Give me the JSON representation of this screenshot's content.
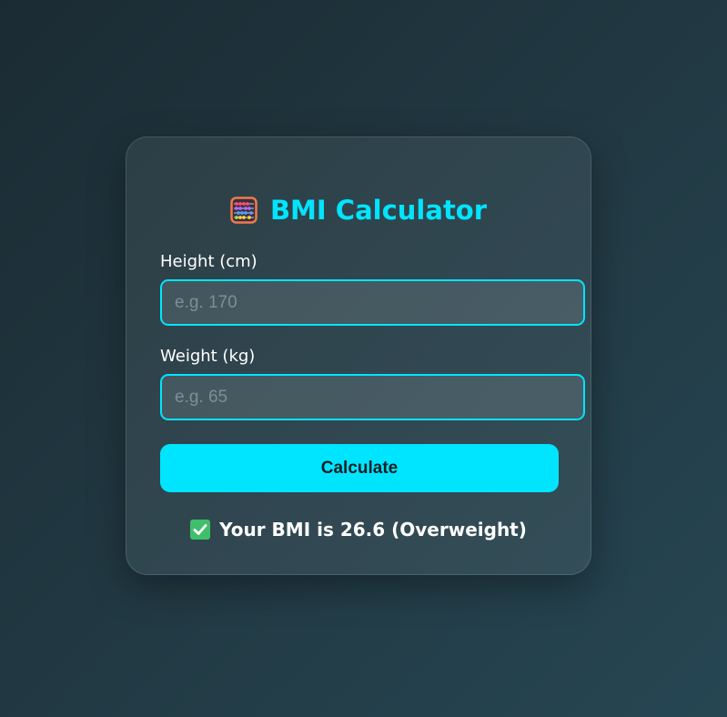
{
  "card": {
    "title": "BMI Calculator",
    "title_icon": "abacus-icon"
  },
  "form": {
    "height": {
      "label": "Height (cm)",
      "value": "",
      "placeholder": "e.g. 170"
    },
    "weight": {
      "label": "Weight (kg)",
      "value": "",
      "placeholder": "e.g. 65"
    },
    "button_label": "Calculate"
  },
  "result": {
    "icon": "check-mark-icon",
    "text": "Your BMI is 26.6 (Overweight)"
  },
  "colors": {
    "accent": "#00e5ff",
    "background": "#223a44",
    "success": "#3fbf6a"
  }
}
